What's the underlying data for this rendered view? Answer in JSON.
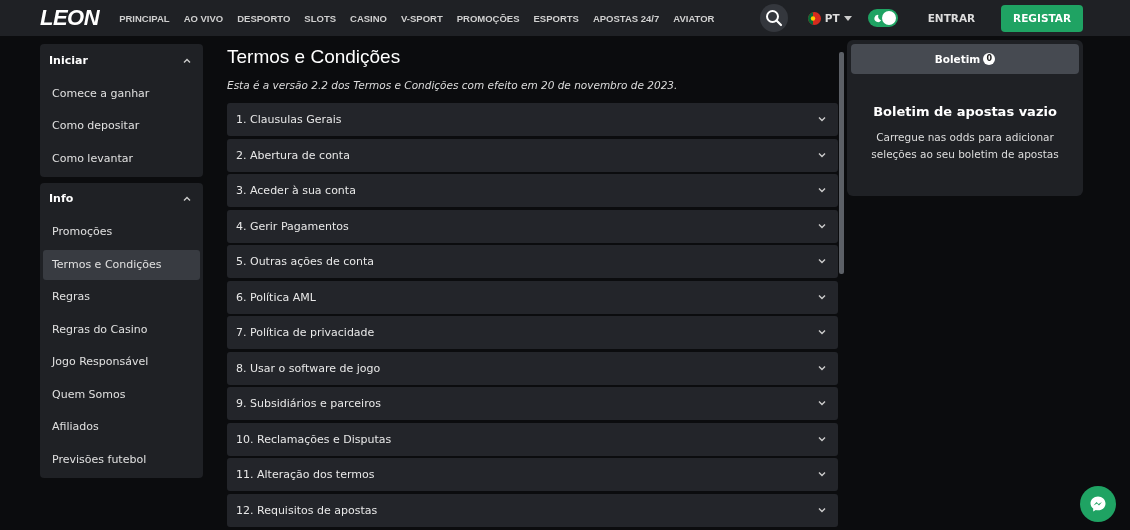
{
  "header": {
    "logo": "LEON",
    "nav": [
      {
        "label": "PRINCIPAL"
      },
      {
        "label": "AO VIVO"
      },
      {
        "label": "DESPORTO"
      },
      {
        "label": "SLOTS"
      },
      {
        "label": "CASINO"
      },
      {
        "label": "V-SPORT"
      },
      {
        "label": "PROMOÇÕES"
      },
      {
        "label": "ESPORTS"
      },
      {
        "label": "APOSTAS 24/7"
      },
      {
        "label": "AVIATOR"
      }
    ],
    "language": "PT",
    "dark_mode": {
      "on": true
    },
    "login": "ENTRAR",
    "register": "REGISTAR"
  },
  "sidebar": [
    {
      "title": "Iniciar",
      "expanded": true,
      "items": [
        {
          "label": "Comece a ganhar",
          "selected": false
        },
        {
          "label": "Como depositar",
          "selected": false
        },
        {
          "label": "Como levantar",
          "selected": false
        }
      ]
    },
    {
      "title": "Info",
      "expanded": true,
      "items": [
        {
          "label": "Promoções",
          "selected": false
        },
        {
          "label": "Termos e Condições",
          "selected": true
        },
        {
          "label": "Regras",
          "selected": false
        },
        {
          "label": "Regras do Casino",
          "selected": false
        },
        {
          "label": "Jogo Responsável",
          "selected": false
        },
        {
          "label": "Quem Somos",
          "selected": false
        },
        {
          "label": "Afiliados",
          "selected": false
        },
        {
          "label": "Previsões futebol",
          "selected": false
        }
      ]
    }
  ],
  "main": {
    "title": "Termos e Condições",
    "intro": "Esta é a versão 2.2 dos Termos e Condições com efeito em 20 de novembro de 2023.",
    "sections": [
      {
        "label": "1. Clausulas Gerais",
        "expanded": false
      },
      {
        "label": "2. Abertura de conta",
        "expanded": false
      },
      {
        "label": "3. Aceder à sua conta",
        "expanded": false
      },
      {
        "label": "4. Gerir Pagamentos",
        "expanded": false
      },
      {
        "label": "5. Outras ações de conta",
        "expanded": false
      },
      {
        "label": "6. Política AML",
        "expanded": false
      },
      {
        "label": "7. Política de privacidade",
        "expanded": false
      },
      {
        "label": "8. Usar o software de jogo",
        "expanded": false
      },
      {
        "label": "9. Subsidiários e parceiros",
        "expanded": false
      },
      {
        "label": "10. Reclamações e Disputas",
        "expanded": false
      },
      {
        "label": "11. Alteração dos termos",
        "expanded": false
      },
      {
        "label": "12. Requisitos de apostas",
        "expanded": false
      }
    ]
  },
  "betslip": {
    "tab": "Boletim",
    "count": "0",
    "empty_title": "Boletim de apostas vazio",
    "empty_text": "Carregue nas odds para adicionar seleções ao seu boletim de apostas"
  }
}
